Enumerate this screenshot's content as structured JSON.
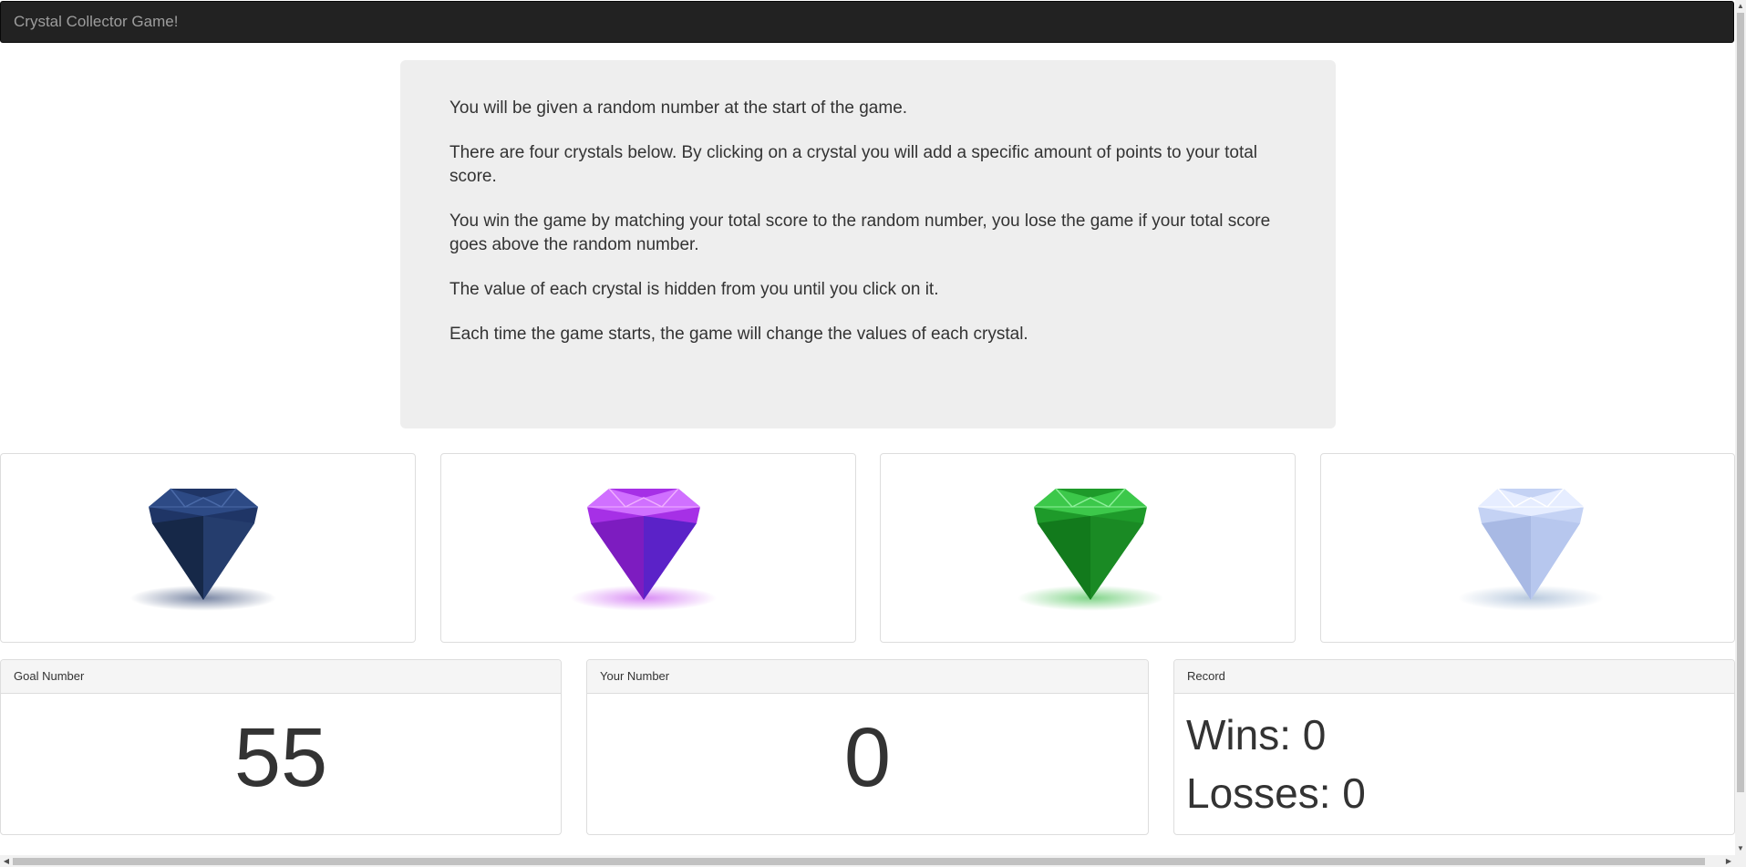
{
  "navbar": {
    "brand": "Crystal Collector Game!"
  },
  "instructions": [
    "You will be given a random number at the start of the game.",
    "There are four crystals below. By clicking on a crystal you will add a specific amount of points to your total score.",
    "You win the game by matching your total score to the random number, you lose the game if your total score goes above the random number.",
    "The value of each crystal is hidden from you until you click on it.",
    "Each time the game starts, the game will change the values of each crystal."
  ],
  "crystals": [
    {
      "name": "blue-crystal",
      "color": "#1f3566"
    },
    {
      "name": "purple-crystal",
      "color": "#a630e6"
    },
    {
      "name": "green-crystal",
      "color": "#1e9a2a"
    },
    {
      "name": "white-crystal",
      "color": "#c4d2f4"
    }
  ],
  "goal": {
    "heading": "Goal Number",
    "value": "55"
  },
  "your_number": {
    "heading": "Your Number",
    "value": "0"
  },
  "record": {
    "heading": "Record",
    "wins": "Wins: 0",
    "losses": "Losses: 0"
  },
  "scrollbar": {
    "up_icon": "▲",
    "down_icon": "▼",
    "left_icon": "◀",
    "right_icon": "▶"
  }
}
